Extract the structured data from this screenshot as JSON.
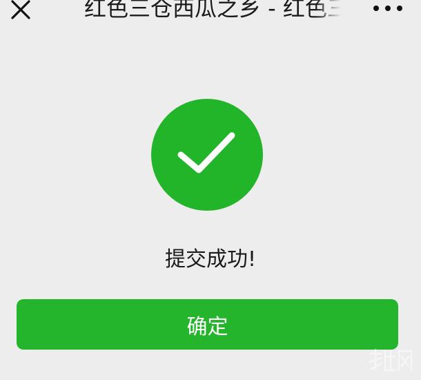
{
  "header": {
    "title": "红色三仓西瓜之乡 - 红色三仓",
    "close_icon": "close-icon",
    "more_icon": "more-dots-icon"
  },
  "result": {
    "icon": "checkmark-icon",
    "icon_color": "#22b52a",
    "message": "提交成功!"
  },
  "actions": {
    "confirm_label": "确定",
    "confirm_color": "#24b52c"
  },
  "watermark": {
    "text": "旅伯网"
  }
}
